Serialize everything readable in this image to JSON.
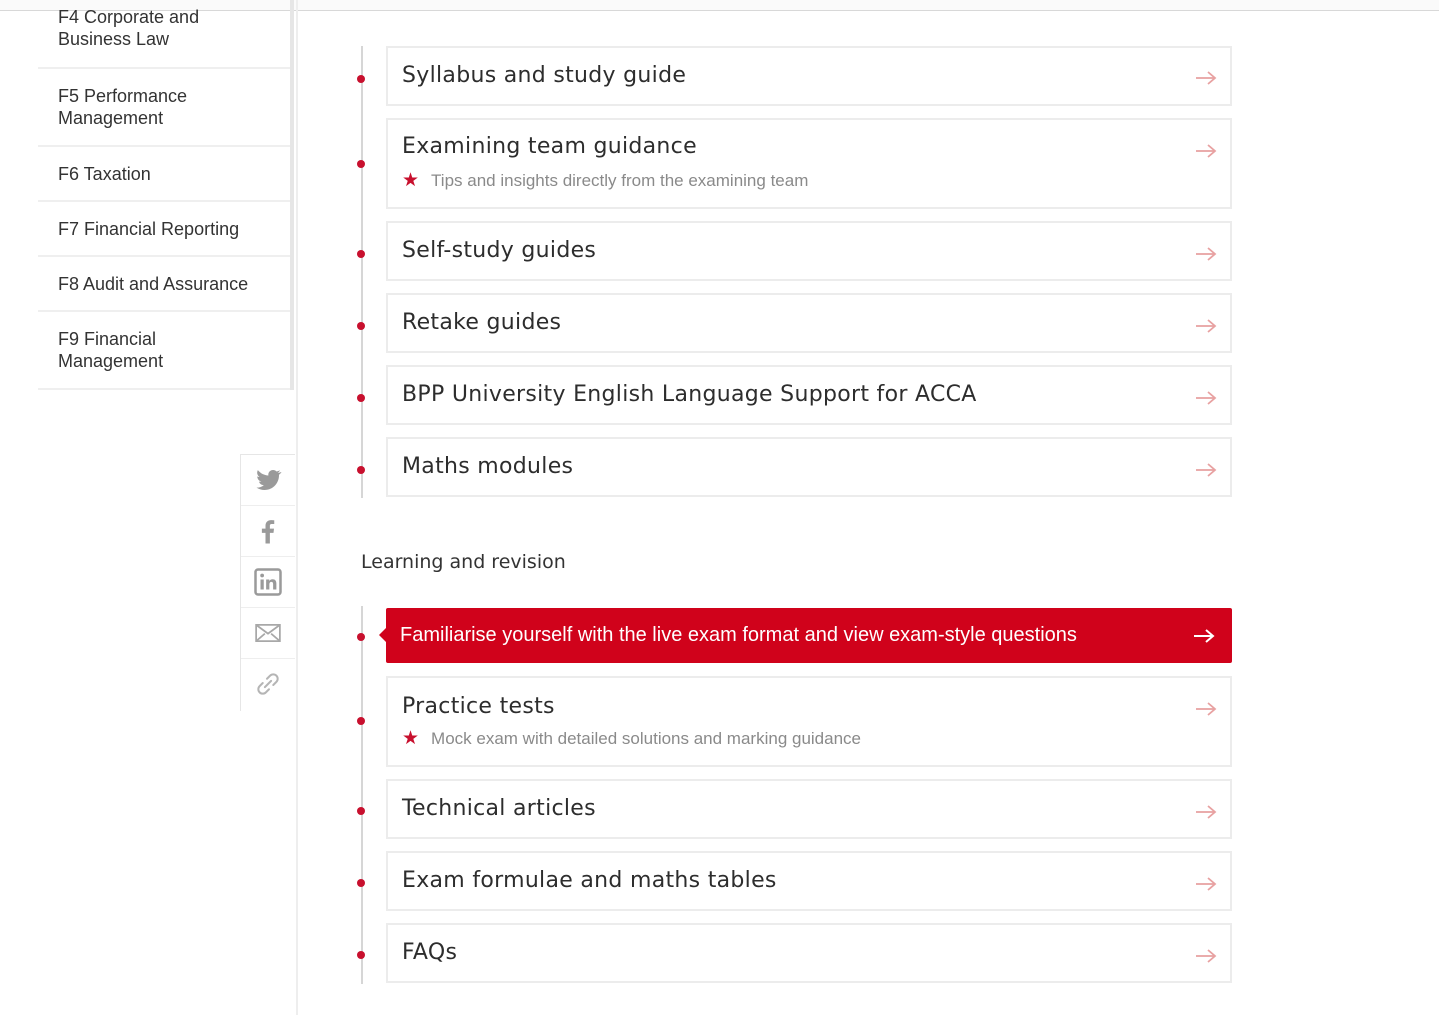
{
  "sidebar": {
    "items": [
      {
        "label": "F4 Corporate and Business Law"
      },
      {
        "label": "F5 Performance Management"
      },
      {
        "label": "F6 Taxation"
      },
      {
        "label": "F7 Financial Reporting"
      },
      {
        "label": "F8 Audit and Assurance"
      },
      {
        "label": "F9 Financial Management"
      }
    ],
    "share": [
      "twitter-icon",
      "facebook-icon",
      "linkedin-icon",
      "email-icon",
      "link-icon"
    ]
  },
  "study_resources": {
    "items": [
      {
        "title": "Syllabus and study guide"
      },
      {
        "title": "Examining team guidance",
        "subtitle": "Tips and insights directly from the examining team"
      },
      {
        "title": "Self-study guides"
      },
      {
        "title": "Retake guides"
      },
      {
        "title": "BPP University English Language Support for ACCA"
      },
      {
        "title": "Maths modules"
      }
    ]
  },
  "learning": {
    "heading": "Learning and revision",
    "featured": {
      "title": "Familiarise yourself with the live exam format and view exam-style questions"
    },
    "items": [
      {
        "title": "Practice tests",
        "subtitle": "Mock exam with detailed solutions and marking guidance"
      },
      {
        "title": "Technical articles"
      },
      {
        "title": "Exam formulae and maths tables"
      },
      {
        "title": "FAQs"
      }
    ]
  },
  "colors": {
    "accent": "#c8102e",
    "featured_bg": "#d0021b",
    "arrow": "#e8a1a1",
    "icon_gray": "#9a9a9a"
  }
}
